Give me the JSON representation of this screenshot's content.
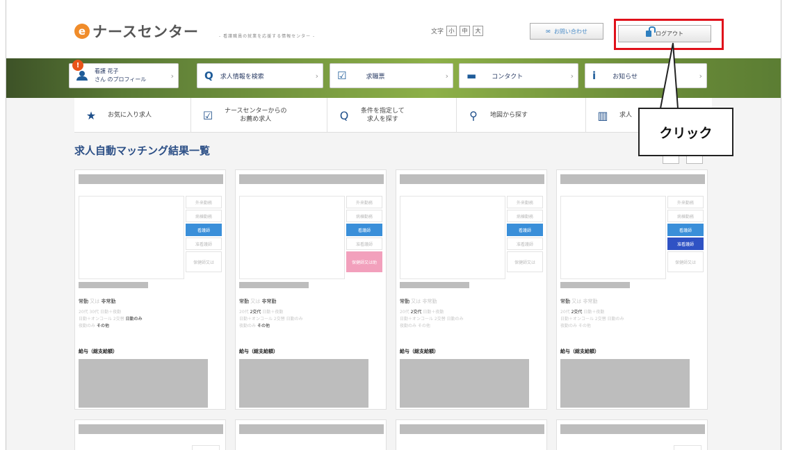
{
  "header": {
    "logo_mark": "e",
    "logo_text": "ナースセンター",
    "tagline": "- 看護職員の就業を応援する情報センター -",
    "font_size_label": "文字",
    "font_sizes": [
      "小",
      "中",
      "大"
    ],
    "contact_label": "お問い合わせ",
    "logout_label": "ログアウト"
  },
  "nav": {
    "profile_badge": "!",
    "profile_name": "看護 花子",
    "profile_label": "さん のプロフィール",
    "search_label": "求人情報を検索",
    "resume_label": "求職票",
    "contact_label": "コンタクト",
    "info_label": "お知らせ",
    "chevron": "›"
  },
  "subnav": {
    "favorites": "お気に入り求人",
    "recommended_l1": "ナースセンターからの",
    "recommended_l2": "お薦め求人",
    "condition_l1": "条件を指定して",
    "condition_l2": "求人を探す",
    "map": "地図から探す",
    "list": "求人"
  },
  "callout": {
    "text": "クリック"
  },
  "page": {
    "title": "求人自動マッチング結果一覧"
  },
  "cards": [
    {
      "tags": [
        "外来勤務",
        "病棟勤務",
        "看護師",
        "准看護師",
        "保健師又は"
      ],
      "emp_type": "常勤",
      "emp_sep": "又は",
      "emp_alt": "非常勤",
      "desc1": "20代 30代 日勤＋夜勤",
      "desc2": "日勤＋オンコール 2交替",
      "desc2_hl": "日勤のみ",
      "desc3": "夜勤のみ",
      "desc3_hl": "その他",
      "salary_label": "給与（総支給額）"
    },
    {
      "tags": [
        "外来勤務",
        "病棟勤務",
        "看護師",
        "准看護師",
        "保健師又は助"
      ],
      "emp_type": "常勤",
      "emp_sep": "又は",
      "emp_alt": "非常勤",
      "desc1": "20代",
      "desc1_hl": "2交代",
      "desc1b": "日勤＋夜勤",
      "desc2": "日勤＋オンコール 2交替 日勤のみ",
      "desc3": "夜勤のみ",
      "desc3_hl": "その他",
      "salary_label": "給与（総支給額）"
    },
    {
      "tags": [
        "外来勤務",
        "病棟勤務",
        "看護師",
        "准看護師",
        "保健師又は"
      ],
      "emp_type": "常勤",
      "emp_sep": "又は",
      "emp_alt": "非常勤",
      "desc1": "20代",
      "desc1_hl": "2交代",
      "desc1b": "日勤＋夜勤",
      "desc2": "日勤＋オンコール 2交替 日勤のみ",
      "desc3": "夜勤のみ その他",
      "salary_label": "給与（総支給額）"
    },
    {
      "tags": [
        "外来勤務",
        "病棟勤務",
        "看護師",
        "准看護師",
        "保健師又は"
      ],
      "emp_type": "常勤",
      "emp_sep": "又は",
      "emp_alt": "非常勤",
      "desc1": "20代",
      "desc1_hl": "2交代",
      "desc1b": "日勤＋夜勤",
      "desc2": "日勤＋オンコール 2交替 日勤のみ",
      "desc3": "夜勤のみ その他",
      "salary_label": "給与（総支給額）"
    }
  ]
}
